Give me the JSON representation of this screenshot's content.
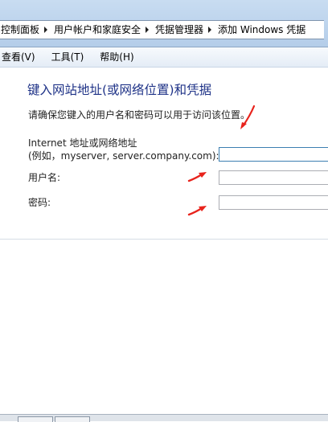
{
  "breadcrumb": {
    "items": [
      "控制面板",
      "用户帐户和家庭安全",
      "凭据管理器",
      "添加 Windows 凭据"
    ]
  },
  "menu": {
    "items": [
      "查看(V)",
      "工具(T)",
      "帮助(H)"
    ]
  },
  "page": {
    "title": "键入网站地址(或网络位置)和凭据",
    "instruction": "请确保您键入的用户名和密码可以用于访问该位置。"
  },
  "form": {
    "address": {
      "label_line1": "Internet 地址或网络地址",
      "label_line2": "(例如，myserver, server.company.com):",
      "value": ""
    },
    "username": {
      "label": "用户名:",
      "value": ""
    },
    "password": {
      "label": "密码:",
      "value": ""
    }
  },
  "colors": {
    "title": "#1e3287",
    "annotation_arrow": "#e8231c"
  }
}
